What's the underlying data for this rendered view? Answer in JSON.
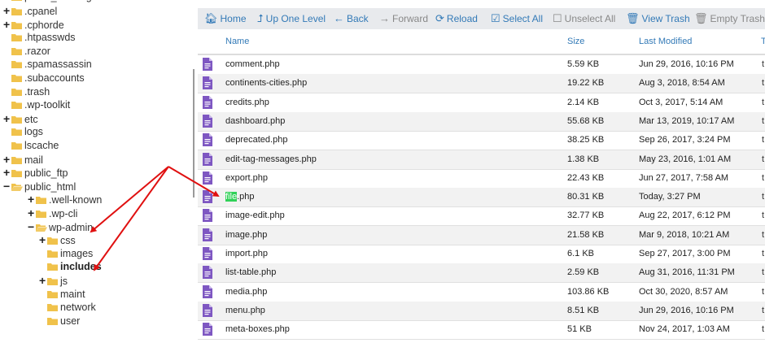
{
  "tree": {
    "items": [
      {
        "label": "public_errorlog",
        "toggle": "",
        "depth": 0,
        "bold": false,
        "open": false
      },
      {
        "label": ".cpanel",
        "toggle": "+",
        "depth": 0,
        "bold": false,
        "open": false
      },
      {
        "label": ".cphorde",
        "toggle": "+",
        "depth": 0,
        "bold": false,
        "open": false
      },
      {
        "label": ".htpasswds",
        "toggle": "",
        "depth": 0,
        "bold": false,
        "open": false
      },
      {
        "label": ".razor",
        "toggle": "",
        "depth": 0,
        "bold": false,
        "open": false
      },
      {
        "label": ".spamassassin",
        "toggle": "",
        "depth": 0,
        "bold": false,
        "open": false
      },
      {
        "label": ".subaccounts",
        "toggle": "",
        "depth": 0,
        "bold": false,
        "open": false
      },
      {
        "label": ".trash",
        "toggle": "",
        "depth": 0,
        "bold": false,
        "open": false
      },
      {
        "label": ".wp-toolkit",
        "toggle": "",
        "depth": 0,
        "bold": false,
        "open": false
      },
      {
        "label": "etc",
        "toggle": "+",
        "depth": 0,
        "bold": false,
        "open": false
      },
      {
        "label": "logs",
        "toggle": "",
        "depth": 0,
        "bold": false,
        "open": false
      },
      {
        "label": "lscache",
        "toggle": "",
        "depth": 0,
        "bold": false,
        "open": false
      },
      {
        "label": "mail",
        "toggle": "+",
        "depth": 0,
        "bold": false,
        "open": false
      },
      {
        "label": "public_ftp",
        "toggle": "+",
        "depth": 0,
        "bold": false,
        "open": false
      },
      {
        "label": "public_html",
        "toggle": "−",
        "depth": 0,
        "bold": false,
        "open": true
      },
      {
        "label": ".well-known",
        "toggle": "+",
        "depth": 1,
        "bold": false,
        "open": false
      },
      {
        "label": ".wp-cli",
        "toggle": "+",
        "depth": 1,
        "bold": false,
        "open": false
      },
      {
        "label": "wp-admin",
        "toggle": "−",
        "depth": 1,
        "bold": false,
        "open": true
      },
      {
        "label": "css",
        "toggle": "+",
        "depth": 2,
        "bold": false,
        "open": false
      },
      {
        "label": "images",
        "toggle": "",
        "depth": 2,
        "bold": false,
        "open": false
      },
      {
        "label": "includes",
        "toggle": "",
        "depth": 2,
        "bold": true,
        "open": false
      },
      {
        "label": "js",
        "toggle": "+",
        "depth": 2,
        "bold": false,
        "open": false
      },
      {
        "label": "maint",
        "toggle": "",
        "depth": 2,
        "bold": false,
        "open": false
      },
      {
        "label": "network",
        "toggle": "",
        "depth": 2,
        "bold": false,
        "open": false
      },
      {
        "label": "user",
        "toggle": "",
        "depth": 2,
        "bold": false,
        "open": false
      }
    ]
  },
  "toolbar": {
    "home": "Home",
    "up": "Up One Level",
    "back": "Back",
    "forward": "Forward",
    "reload": "Reload",
    "select_all": "Select All",
    "unselect_all": "Unselect All",
    "view_trash": "View Trash",
    "empty_trash": "Empty Trash"
  },
  "table": {
    "headers": {
      "name": "Name",
      "size": "Size",
      "modified": "Last Modified",
      "type": "T"
    },
    "rows": [
      {
        "name": "comment.php",
        "size": "5.59 KB",
        "modified": "Jun 29, 2016, 10:16 PM",
        "type": "t"
      },
      {
        "name": "continents-cities.php",
        "size": "19.22 KB",
        "modified": "Aug 3, 2018, 8:54 AM",
        "type": "t"
      },
      {
        "name": "credits.php",
        "size": "2.14 KB",
        "modified": "Oct 3, 2017, 5:14 AM",
        "type": "t"
      },
      {
        "name": "dashboard.php",
        "size": "55.68 KB",
        "modified": "Mar 13, 2019, 10:17 AM",
        "type": "t"
      },
      {
        "name": "deprecated.php",
        "size": "38.25 KB",
        "modified": "Sep 26, 2017, 3:24 PM",
        "type": "t"
      },
      {
        "name": "edit-tag-messages.php",
        "size": "1.38 KB",
        "modified": "May 23, 2016, 1:01 AM",
        "type": "t"
      },
      {
        "name": "export.php",
        "size": "22.43 KB",
        "modified": "Jun 27, 2017, 7:58 AM",
        "type": "t"
      },
      {
        "name_hl": "file",
        "name_rest": ".php",
        "size": "80.31 KB",
        "modified": "Today, 3:27 PM",
        "type": "t"
      },
      {
        "name": "image-edit.php",
        "size": "32.77 KB",
        "modified": "Aug 22, 2017, 6:12 PM",
        "type": "t"
      },
      {
        "name": "image.php",
        "size": "21.58 KB",
        "modified": "Mar 9, 2018, 10:21 AM",
        "type": "t"
      },
      {
        "name": "import.php",
        "size": "6.1 KB",
        "modified": "Sep 27, 2017, 3:00 PM",
        "type": "t"
      },
      {
        "name": "list-table.php",
        "size": "2.59 KB",
        "modified": "Aug 31, 2016, 11:31 PM",
        "type": "t"
      },
      {
        "name": "media.php",
        "size": "103.86 KB",
        "modified": "Oct 30, 2020, 8:57 AM",
        "type": "t"
      },
      {
        "name": "menu.php",
        "size": "8.51 KB",
        "modified": "Jun 29, 2016, 10:16 PM",
        "type": "t"
      },
      {
        "name": "meta-boxes.php",
        "size": "51 KB",
        "modified": "Nov 24, 2017, 1:03 AM",
        "type": "t"
      }
    ]
  },
  "colors": {
    "accent": "#337ab7",
    "folder": "#f0c24b",
    "file_icon": "#7e57c2",
    "highlight": "#30d158",
    "arrow": "#e01010"
  },
  "icons": [
    "home-icon",
    "level-up-icon",
    "arrow-left-icon",
    "arrow-right-icon",
    "reload-icon",
    "checkbox-checked-icon",
    "checkbox-empty-icon",
    "trash-icon",
    "folder-icon",
    "file-icon"
  ]
}
